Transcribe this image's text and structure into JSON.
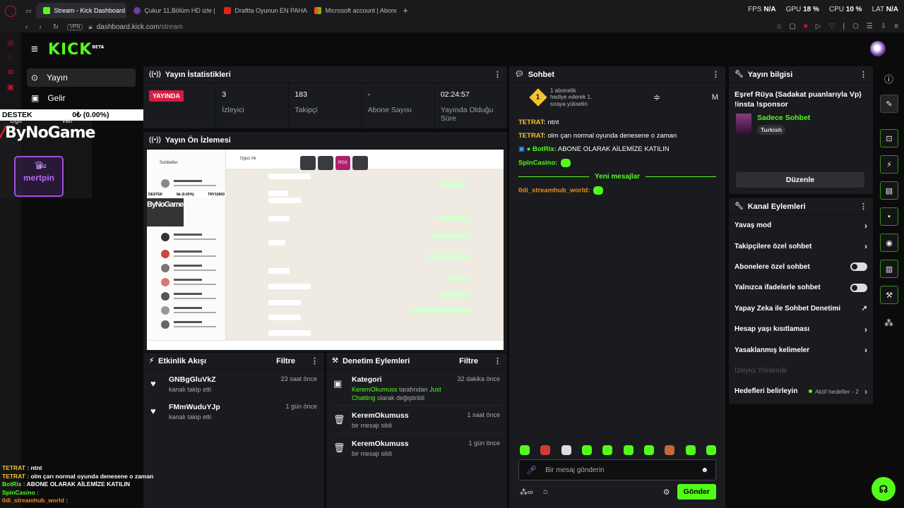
{
  "browser": {
    "tabs": [
      {
        "title": "Stream - Kick Dashboard",
        "color": "#53fc18",
        "active": true
      },
      {
        "title": "Çukur 11.Bölüm HD izle | …",
        "color": "#6b3da8",
        "active": false
      },
      {
        "title": "Draftta Oyunun EN PAHAL…",
        "color": "#e62117",
        "active": false
      },
      {
        "title": "Microsoft account | Abone…",
        "color": "#f25022",
        "active": false
      }
    ],
    "new_tab": "+",
    "stats": {
      "fps_label": "FPS",
      "fps": "N/A",
      "gpu_label": "GPU",
      "gpu": "18 %",
      "cpu_label": "CPU",
      "cpu": "10 %",
      "lat_label": "LAT",
      "lat": "N/A"
    },
    "vpn": "VPN",
    "url_host": "dashboard.kick.com",
    "url_path": "/stream"
  },
  "kick": {
    "logo": "KICK",
    "beta": "BETA"
  },
  "leftnav": {
    "items": [
      {
        "label": "Yayın",
        "icon": "broadcast-icon",
        "active": true
      },
      {
        "label": "Gelir",
        "icon": "money-icon",
        "active": false
      }
    ]
  },
  "overlay": {
    "destek": "DESTEK",
    "amount": "0₺ (0.00%)",
    "goal": "TRY10000",
    "bynogame": "ByNoGame",
    "mertpin": "mertpin",
    "top_names": [
      "Oğu",
      "vatı",
      "siz"
    ]
  },
  "stats_panel": {
    "title": "Yayın İstatistikleri",
    "live_badge": "YAYINDA",
    "cells": [
      {
        "value": "3",
        "label": "İzleyici"
      },
      {
        "value": "183",
        "label": "Takipçi"
      },
      {
        "value": "-",
        "label": "Abone Sayısı"
      },
      {
        "value": "02:24:57",
        "label": "Yayında Olduğu Süre"
      }
    ]
  },
  "preview_panel": {
    "title": "Yayın Ön İzlemesi",
    "inner_title": "Sohbetler",
    "inner_contact": "Oguz Ak",
    "inner_rgx": "RGX"
  },
  "activity_panel": {
    "title": "Etkinlik Akışı",
    "filter": "Filtre",
    "items": [
      {
        "name": "GNBgGluVkZ",
        "action": "kanalı takip etti",
        "time": "23 saat önce"
      },
      {
        "name": "FMmWuduYJp",
        "action": "kanalı takip etti",
        "time": "1 gün önce"
      }
    ]
  },
  "moderation_panel": {
    "title": "Denetim Eylemleri",
    "filter": "Filtre",
    "items": [
      {
        "title": "Kategori",
        "user": "KeremOkumuss",
        "mid": " tarafından ",
        "cat": "Just Chatting",
        "end": " olarak değiştirildi",
        "time": "32 dakika önce"
      },
      {
        "title": "KeremOkumuss",
        "sub": "bir mesajı sildi",
        "time": "1 saat önce"
      },
      {
        "title": "KeremOkumuss",
        "sub": "bir mesajı sildi",
        "time": "1 gün önce"
      }
    ]
  },
  "chat_panel": {
    "title": "Sohbet",
    "pinned_num": "1",
    "pinned_text": "1 abonelik hediye ederek 1. sıraya yükselin",
    "pinned_m": "M",
    "messages": [
      {
        "user": "TETRAT:",
        "text": " ntnt",
        "color": "#f4c430"
      },
      {
        "user": "TETRAT:",
        "text": " olm çarı normal oyunda denesene o zaman",
        "color": "#f4c430"
      },
      {
        "user": "BotRix:",
        "text": " ABONE OLARAK AİLEMİZE KATILIN",
        "color": "#53fc18"
      },
      {
        "user": "SpinCasino:",
        "text": "",
        "color": "#53fc18"
      }
    ],
    "new_messages": "Yeni mesajlar",
    "after": {
      "user": "0di_streamhub_world:",
      "color": "#f08c1a"
    },
    "input_placeholder": "Bir mesaj gönderin",
    "send": "Gönder"
  },
  "stream_info": {
    "title": "Yayın bilgisi",
    "stream_title": "Eşref Rüya (Sadakat puanlarıyla Vp) !insta !sponsor",
    "category": "Sadece Sohbet",
    "tag": "Turkish",
    "edit": "Düzenle"
  },
  "channel_actions": {
    "title": "Kanal Eylemleri",
    "rows": [
      {
        "label": "Yavaş mod",
        "kind": "chevron"
      },
      {
        "label": "Takipçilere özel sohbet",
        "kind": "chevron"
      },
      {
        "label": "Abonelere özel sohbet",
        "kind": "toggle"
      },
      {
        "label": "Yalnızca ifadelerle sohbet",
        "kind": "toggle"
      },
      {
        "label": "Yapay Zeka ile Sohbet Denetimi",
        "kind": "external"
      },
      {
        "label": "Hesap yaşı kısıtlaması",
        "kind": "chevron"
      },
      {
        "label": "Yasaklanmış kelimeler",
        "kind": "chevron"
      },
      {
        "label": "İzleyici Yönlendir",
        "kind": "disabled"
      },
      {
        "label": "Hedefleri belirleyin",
        "kind": "goal",
        "goal": "Aktif hedefler - 2"
      }
    ]
  },
  "overlay_chat": [
    {
      "user": "TETRAT :",
      "text": " ntnt"
    },
    {
      "user": "TETRAT :",
      "text": " olm çarı normal oyunda denesene o zaman"
    },
    {
      "user": "BotRix :",
      "text": " ABONE OLARAK AİLEMİZE KATILIN"
    },
    {
      "user": "SpinCasino :",
      "text": ""
    },
    {
      "user": "0di_streamhub_world :",
      "text": ""
    }
  ]
}
